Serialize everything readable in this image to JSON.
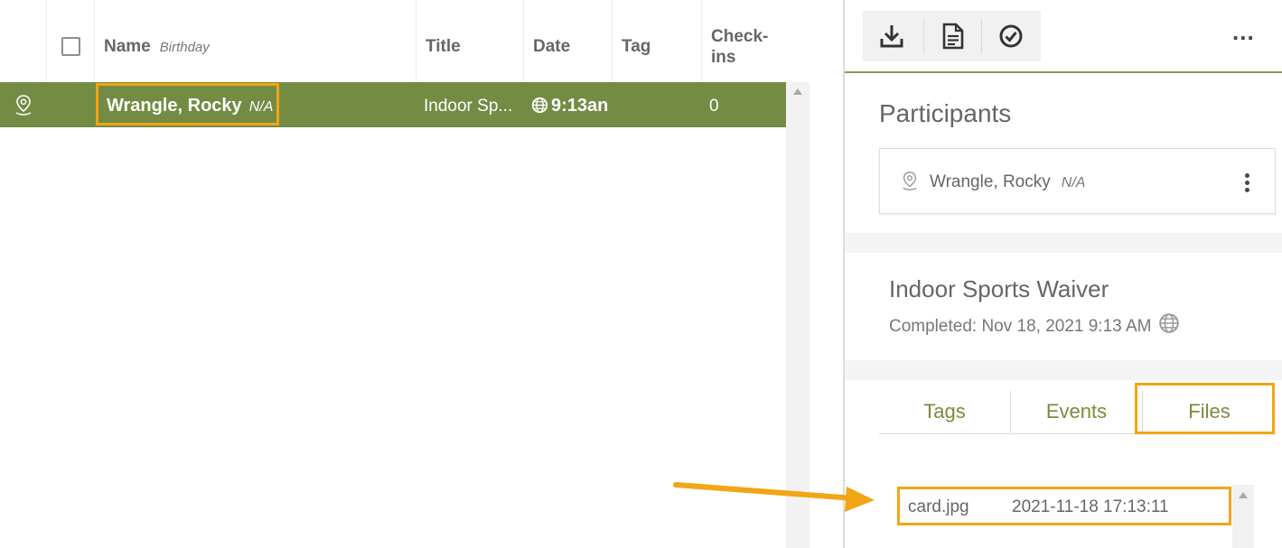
{
  "table": {
    "headers": {
      "name": "Name",
      "birthday": "Birthday",
      "title": "Title",
      "date": "Date",
      "tag": "Tag",
      "checkins_line1": "Check-",
      "checkins_line2": "ins"
    },
    "rows": [
      {
        "name": "Wrangle, Rocky",
        "birthday": "N/A",
        "title": "Indoor Sp...",
        "date": "9:13an",
        "tag": "",
        "checkins": "0"
      }
    ],
    "row_color": "#748b44"
  },
  "toolbar": {
    "download_icon": "download-icon",
    "document_icon": "document-icon",
    "check_icon": "check-circle-icon",
    "more_label": "..."
  },
  "participants": {
    "title": "Participants",
    "items": [
      {
        "name": "Wrangle, Rocky",
        "birthday": "N/A"
      }
    ]
  },
  "waiver": {
    "title": "Indoor Sports Waiver",
    "completed": "Completed: Nov 18, 2021 9:13 AM"
  },
  "tabs": {
    "items": [
      "Tags",
      "Events",
      "Files"
    ],
    "active": "Files"
  },
  "files": {
    "items": [
      {
        "name": "card.jpg",
        "date": "2021-11-18 17:13:11"
      }
    ]
  },
  "colors": {
    "accent_green": "#748b44",
    "highlight_orange": "#f2a516"
  }
}
